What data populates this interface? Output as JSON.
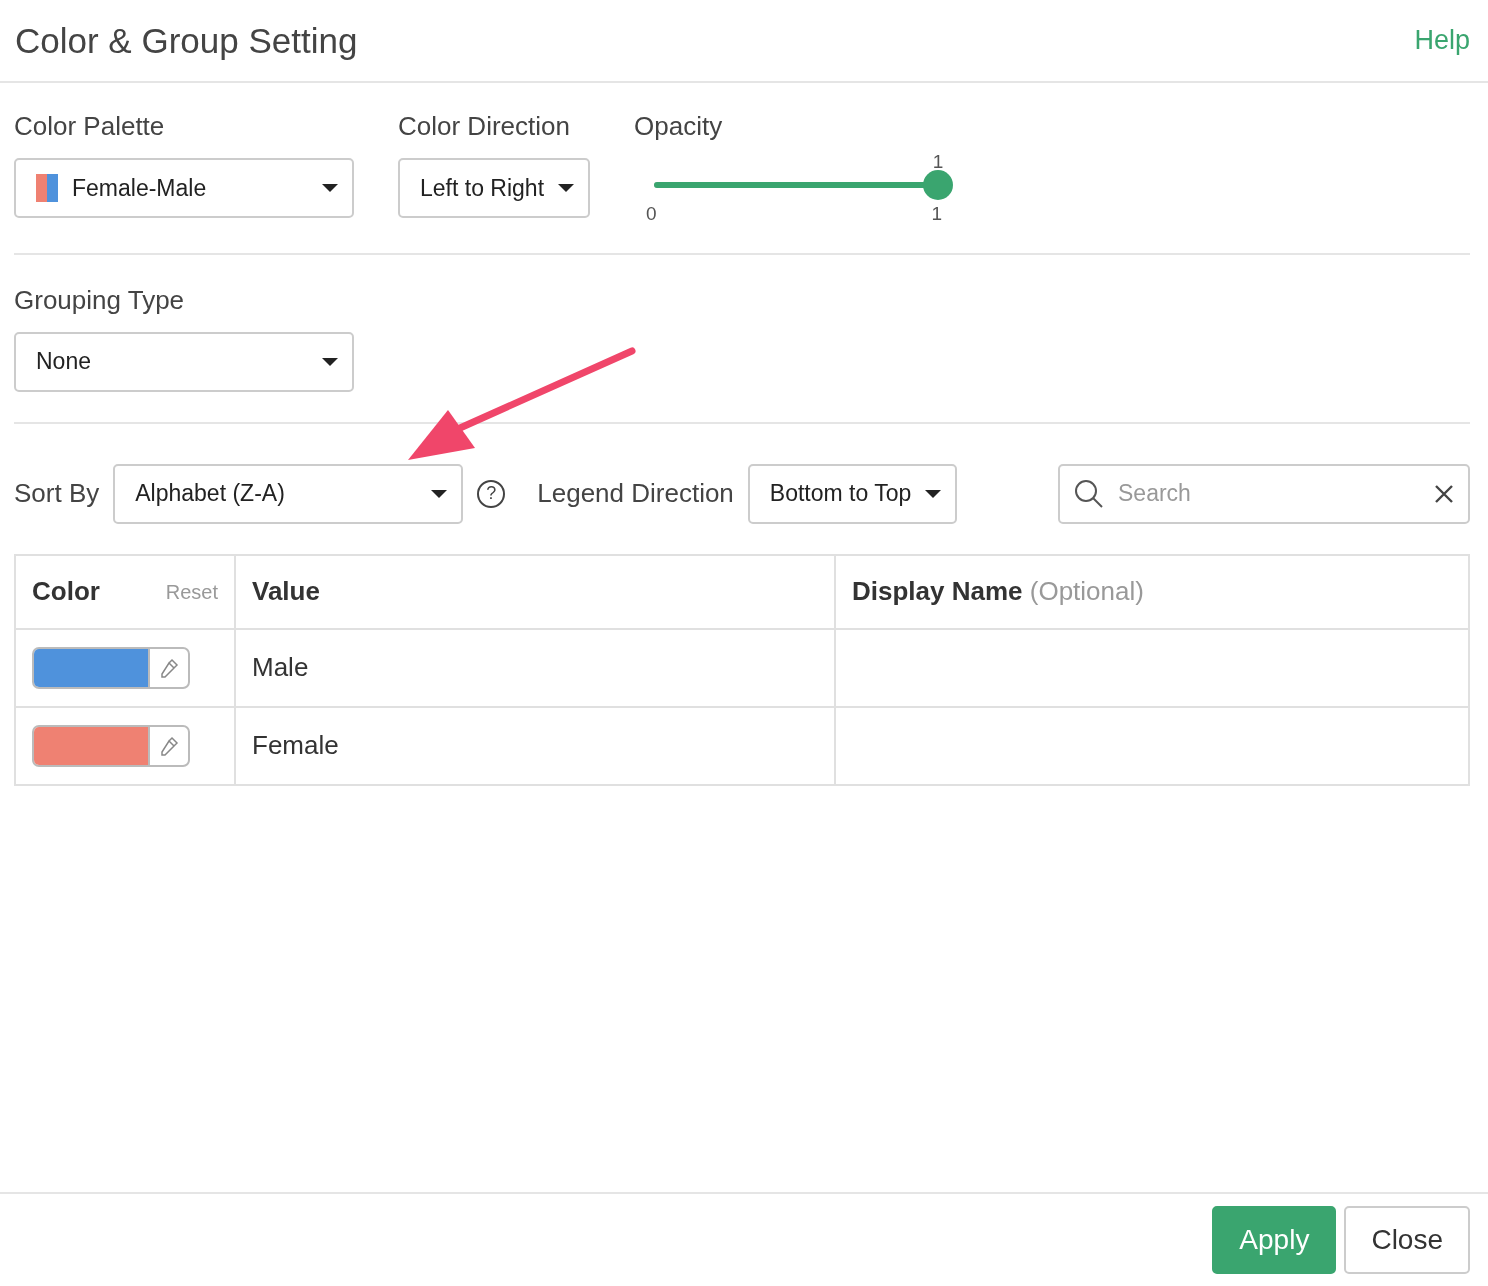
{
  "dialog": {
    "title": "Color & Group Setting",
    "help_link": "Help"
  },
  "color_palette": {
    "label": "Color Palette",
    "value": "Female-Male"
  },
  "color_direction": {
    "label": "Color Direction",
    "value": "Left to Right"
  },
  "opacity": {
    "label": "Opacity",
    "level": 1,
    "value": "1",
    "min": "0",
    "max": "1"
  },
  "grouping_type": {
    "label": "Grouping Type",
    "value": "None"
  },
  "sort_by": {
    "label": "Sort By",
    "value": "Alphabet (Z-A)",
    "help": "?"
  },
  "legend_direction": {
    "label": "Legend Direction",
    "value": "Bottom to Top"
  },
  "search": {
    "placeholder": "Search"
  },
  "table": {
    "columns": [
      {
        "label": "Color",
        "action": "Reset"
      },
      {
        "label": "Value"
      },
      {
        "label": "Display Name",
        "hint": "(Optional)"
      }
    ],
    "rows": [
      {
        "color": "#4f92dc",
        "value": "Male"
      },
      {
        "color": "#ef8172",
        "value": "Female"
      }
    ]
  },
  "buttons": [
    {
      "label": "Apply",
      "kind": "primary"
    },
    {
      "label": "Close",
      "kind": "secondary"
    }
  ]
}
